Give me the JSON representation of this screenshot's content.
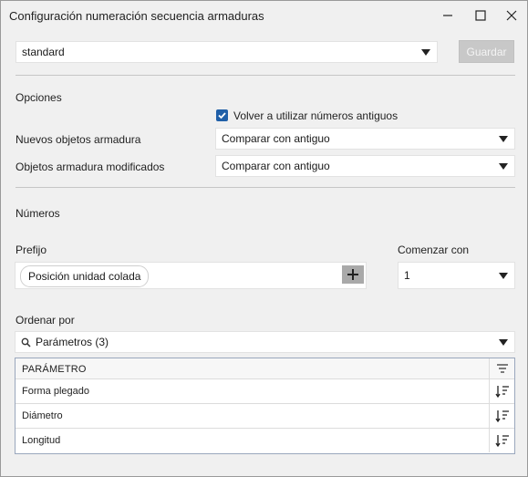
{
  "window": {
    "title": "Configuración numeración secuencia armaduras"
  },
  "top": {
    "preset_value": "standard",
    "save_label": "Guardar"
  },
  "options": {
    "heading": "Opciones",
    "reuse_label": "Volver a utilizar números antiguos",
    "reuse_checked": true,
    "new_objects_label": "Nuevos objetos armadura",
    "new_objects_value": "Comparar con antiguo",
    "modified_objects_label": "Objetos armadura modificados",
    "modified_objects_value": "Comparar con antiguo"
  },
  "numbers": {
    "heading": "Números",
    "prefix_label": "Prefijo",
    "prefix_chip": "Posición unidad colada",
    "start_label": "Comenzar con",
    "start_value": "1"
  },
  "sort": {
    "label": "Ordenar por",
    "selector_value": "Parámetros (3)",
    "column_header": "PARÁMETRO",
    "rows": [
      "Forma plegado",
      "Diámetro",
      "Longitud"
    ]
  },
  "colors": {
    "accent": "#1f5fa8",
    "disabled_button": "#c8c8c8",
    "table_border": "#9aa7bd"
  }
}
